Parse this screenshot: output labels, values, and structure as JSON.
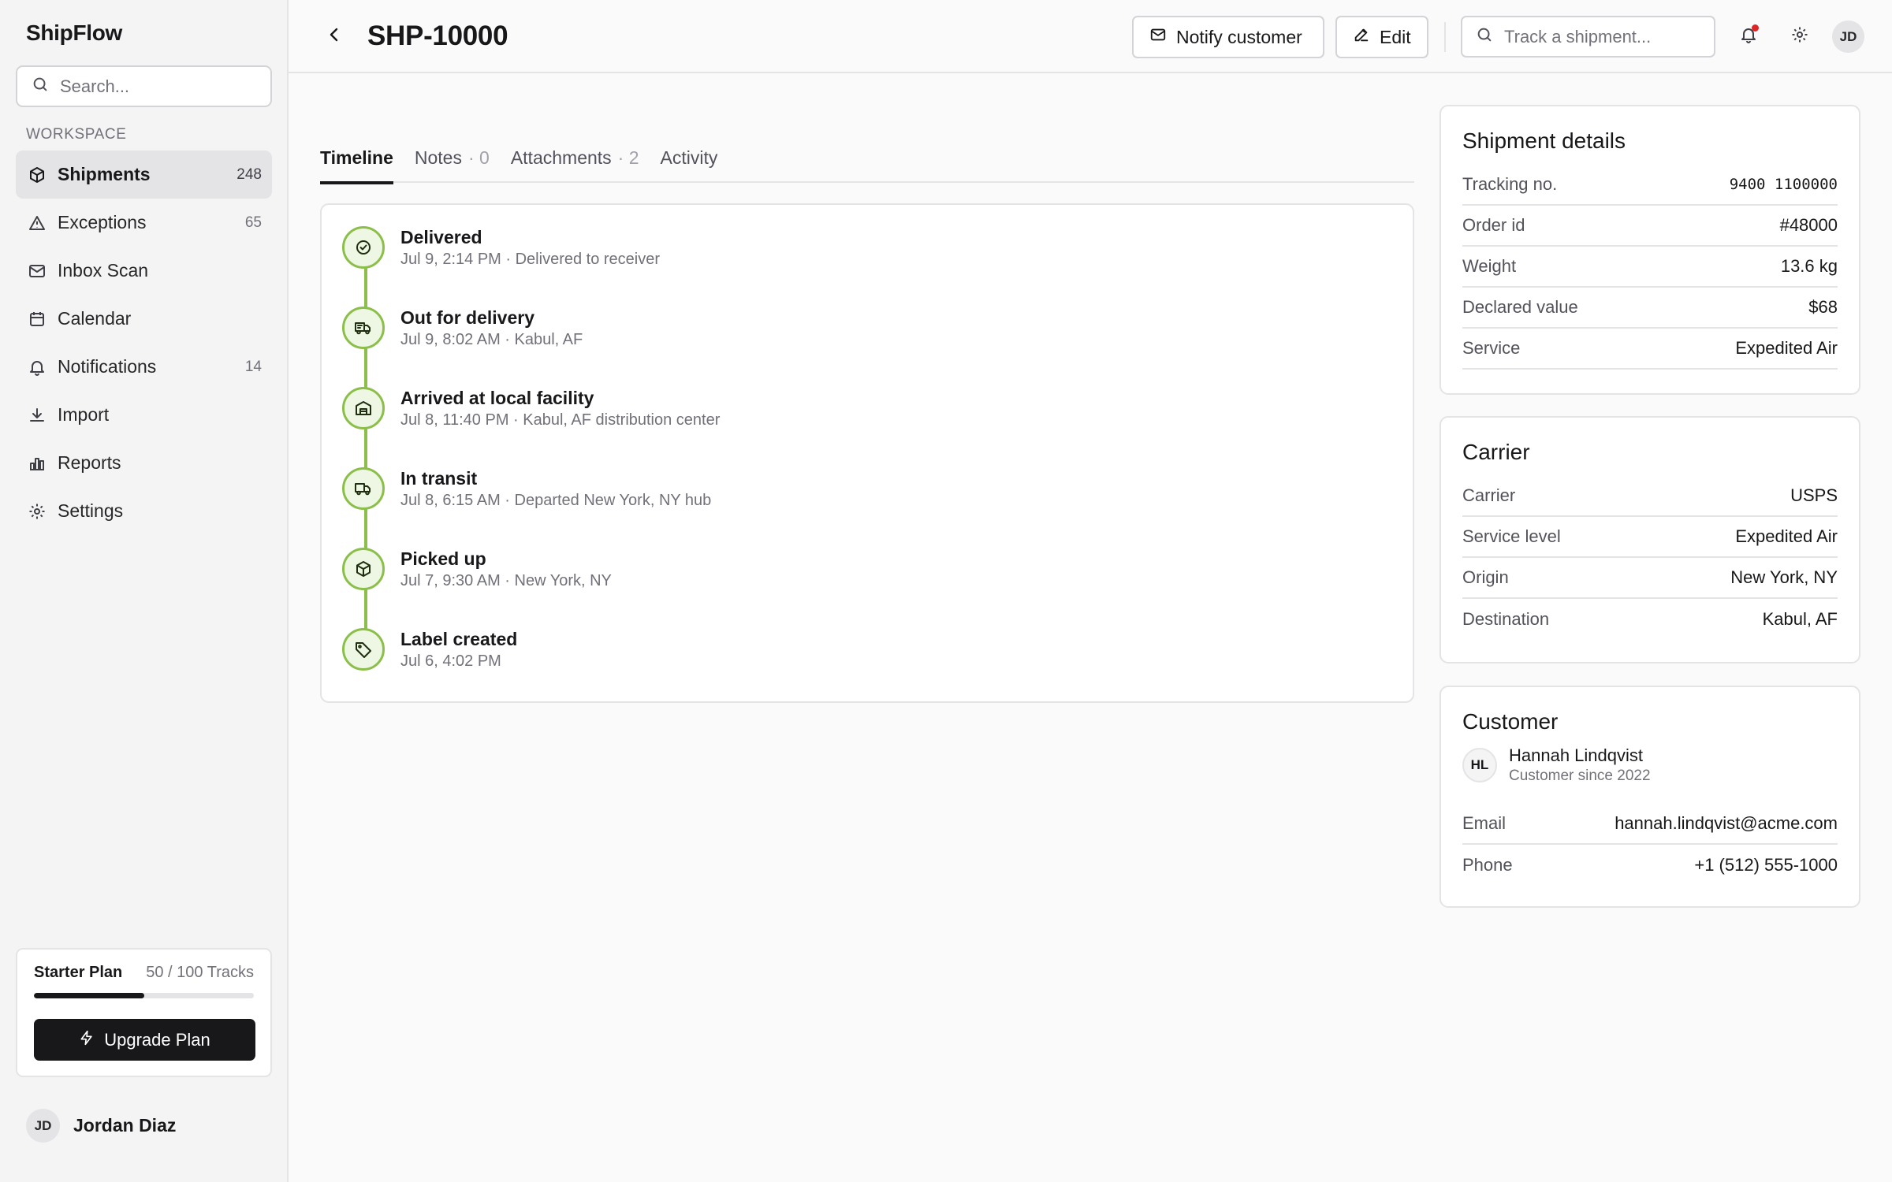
{
  "app": {
    "name": "ShipFlow"
  },
  "sidebar": {
    "search_placeholder": "Search...",
    "section_label": "WORKSPACE",
    "items": [
      {
        "label": "Shipments",
        "count": "248",
        "icon": "package-icon",
        "active": true
      },
      {
        "label": "Exceptions",
        "count": "65",
        "icon": "warning-icon"
      },
      {
        "label": "Inbox Scan",
        "count": "",
        "icon": "mail-icon"
      },
      {
        "label": "Calendar",
        "count": "",
        "icon": "calendar-icon"
      },
      {
        "label": "Notifications",
        "count": "14",
        "icon": "bell-icon"
      },
      {
        "label": "Import",
        "count": "",
        "icon": "download-icon"
      },
      {
        "label": "Reports",
        "count": "",
        "icon": "bar-chart-icon"
      },
      {
        "label": "Settings",
        "count": "",
        "icon": "gear-icon"
      }
    ],
    "plan": {
      "name": "Starter Plan",
      "usage": "50 / 100 Tracks",
      "progress": 0.5,
      "upgrade_label": "Upgrade Plan"
    },
    "user": {
      "initials": "JD",
      "name": "Jordan Diaz"
    }
  },
  "header": {
    "title": "SHP-10000",
    "notify_label": "Notify customer",
    "edit_label": "Edit",
    "search_placeholder": "Track a shipment...",
    "avatar_initials": "JD"
  },
  "tabs": [
    {
      "label": "Timeline",
      "count": "",
      "active": true
    },
    {
      "label": "Notes",
      "count": "· 0"
    },
    {
      "label": "Attachments",
      "count": "· 2"
    },
    {
      "label": "Activity",
      "count": ""
    }
  ],
  "timeline": [
    {
      "title": "Delivered",
      "subtitle": "Jul 9, 2:14 PM · Delivered to receiver",
      "icon": "check-circle-icon"
    },
    {
      "title": "Out for delivery",
      "subtitle": "Jul 9, 8:02 AM · Kabul, AF",
      "icon": "delivery-truck-icon"
    },
    {
      "title": "Arrived at local facility",
      "subtitle": "Jul 8, 11:40 PM · Kabul, AF distribution center",
      "icon": "warehouse-icon"
    },
    {
      "title": "In transit",
      "subtitle": "Jul 8, 6:15 AM · Departed New York, NY hub",
      "icon": "truck-icon"
    },
    {
      "title": "Picked up",
      "subtitle": "Jul 7, 9:30 AM · New York, NY",
      "icon": "package-icon"
    },
    {
      "title": "Label created",
      "subtitle": "Jul 6, 4:02 PM",
      "icon": "tag-icon"
    }
  ],
  "shipment_details": {
    "title": "Shipment details",
    "rows": [
      {
        "label": "Tracking no.",
        "value": "9400 1100000"
      },
      {
        "label": "Order id",
        "value": "#48000"
      },
      {
        "label": "Weight",
        "value": "13.6 kg"
      },
      {
        "label": "Declared value",
        "value": "$68"
      },
      {
        "label": "Service",
        "value": "Expedited Air"
      }
    ]
  },
  "carrier": {
    "title": "Carrier",
    "rows": [
      {
        "label": "Carrier",
        "value": "USPS"
      },
      {
        "label": "Service level",
        "value": "Expedited Air"
      },
      {
        "label": "Origin",
        "value": "New York, NY"
      },
      {
        "label": "Destination",
        "value": "Kabul, AF"
      }
    ]
  },
  "customer": {
    "title": "Customer",
    "initials": "HL",
    "name": "Hannah Lindqvist",
    "since": "Customer since 2022",
    "rows": [
      {
        "label": "Email",
        "value": "hannah.lindqvist@acme.com"
      },
      {
        "label": "Phone",
        "value": "+1 (512) 555-1000"
      }
    ]
  },
  "colors": {
    "accent": "#18181b",
    "timeline_green": "#8bbf4a",
    "notification_dot": "#dc2626"
  }
}
